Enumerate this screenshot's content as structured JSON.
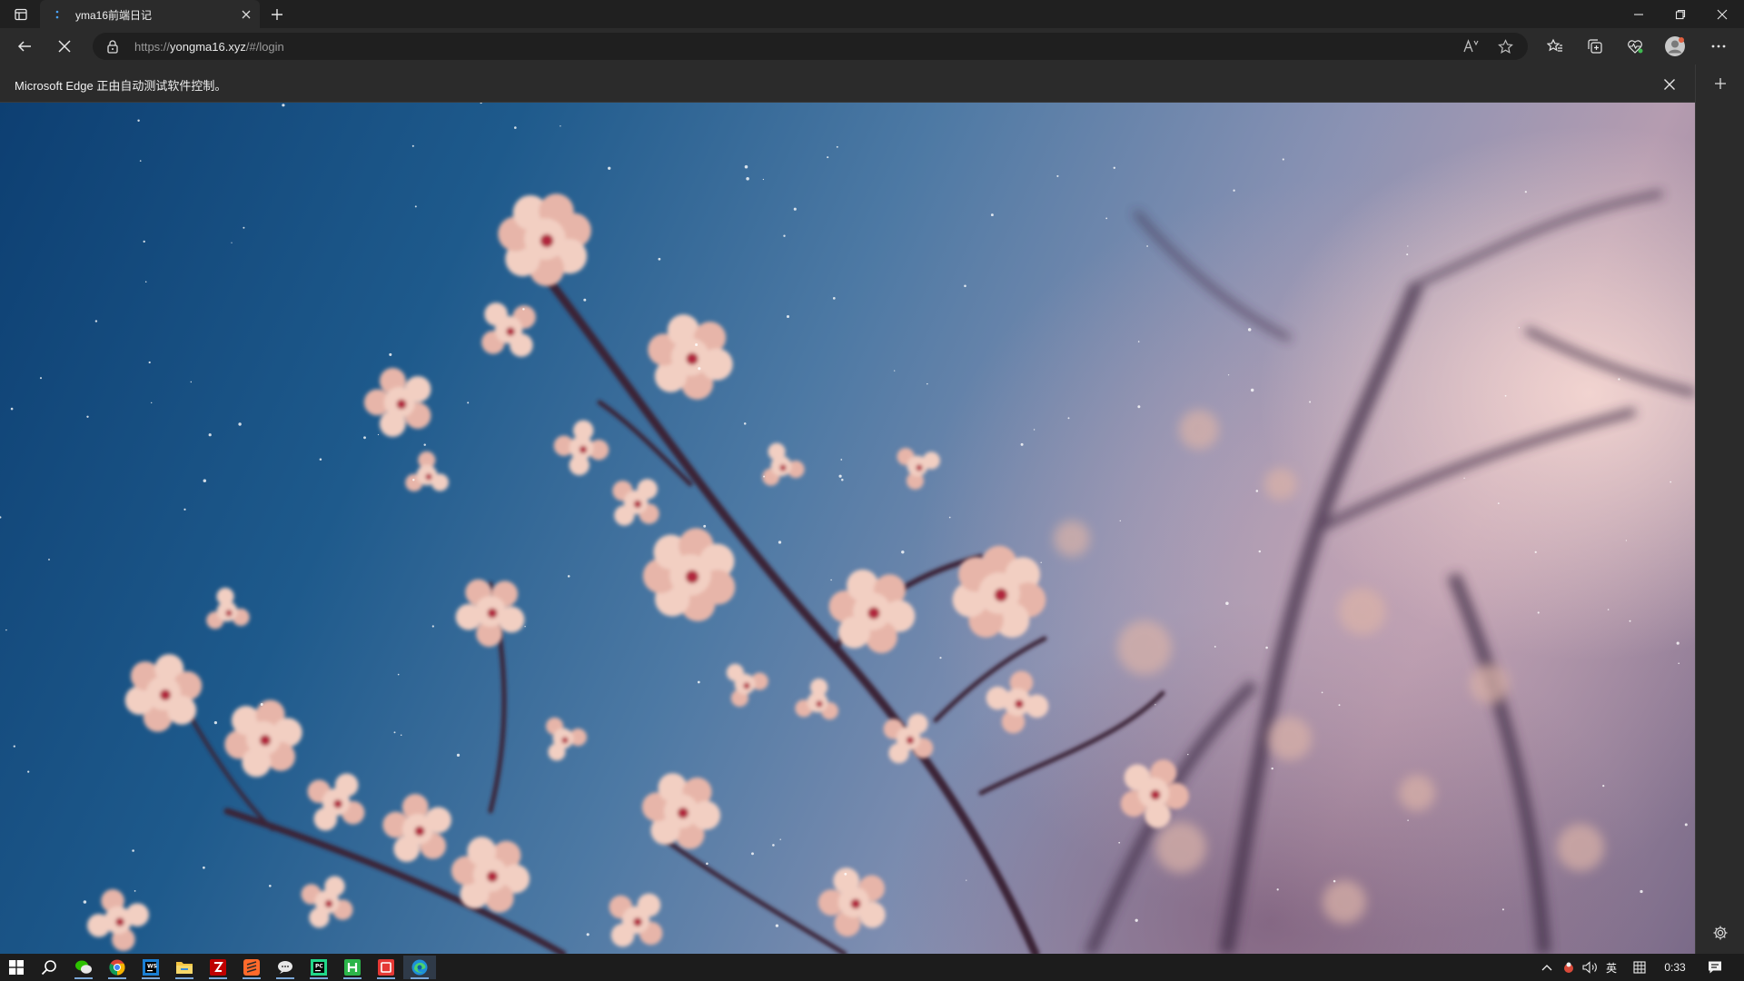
{
  "browser": {
    "tab": {
      "title": "yma16前端日记"
    },
    "address": {
      "scheme": "https://",
      "host": "yongma16.xyz",
      "path": "/#/login"
    },
    "infobar": {
      "message": "Microsoft Edge 正由自动测试软件控制。"
    },
    "toolbar_icons": [
      "back-icon",
      "stop-icon",
      "read-aloud-icon",
      "favorite-icon",
      "favorites-icon",
      "collections-icon",
      "browser-essentials-icon",
      "profile-icon",
      "more-icon"
    ],
    "sidebar_icons": [
      "add-icon",
      "settings-icon"
    ]
  },
  "taskbar": {
    "apps": [
      "start",
      "search",
      "wechat",
      "chrome",
      "webstorm",
      "file-explorer",
      "filezilla",
      "sublime",
      "wechat-bubble",
      "pycharm",
      "hbuilder",
      "jetbrains-red",
      "edge"
    ],
    "tray": {
      "ime_lang": "英",
      "clock": "0:33"
    }
  },
  "colors": {
    "accent": "#7aa7d8",
    "sky_blue": "#1e5a8c",
    "blossom": "#f0c8bc"
  }
}
